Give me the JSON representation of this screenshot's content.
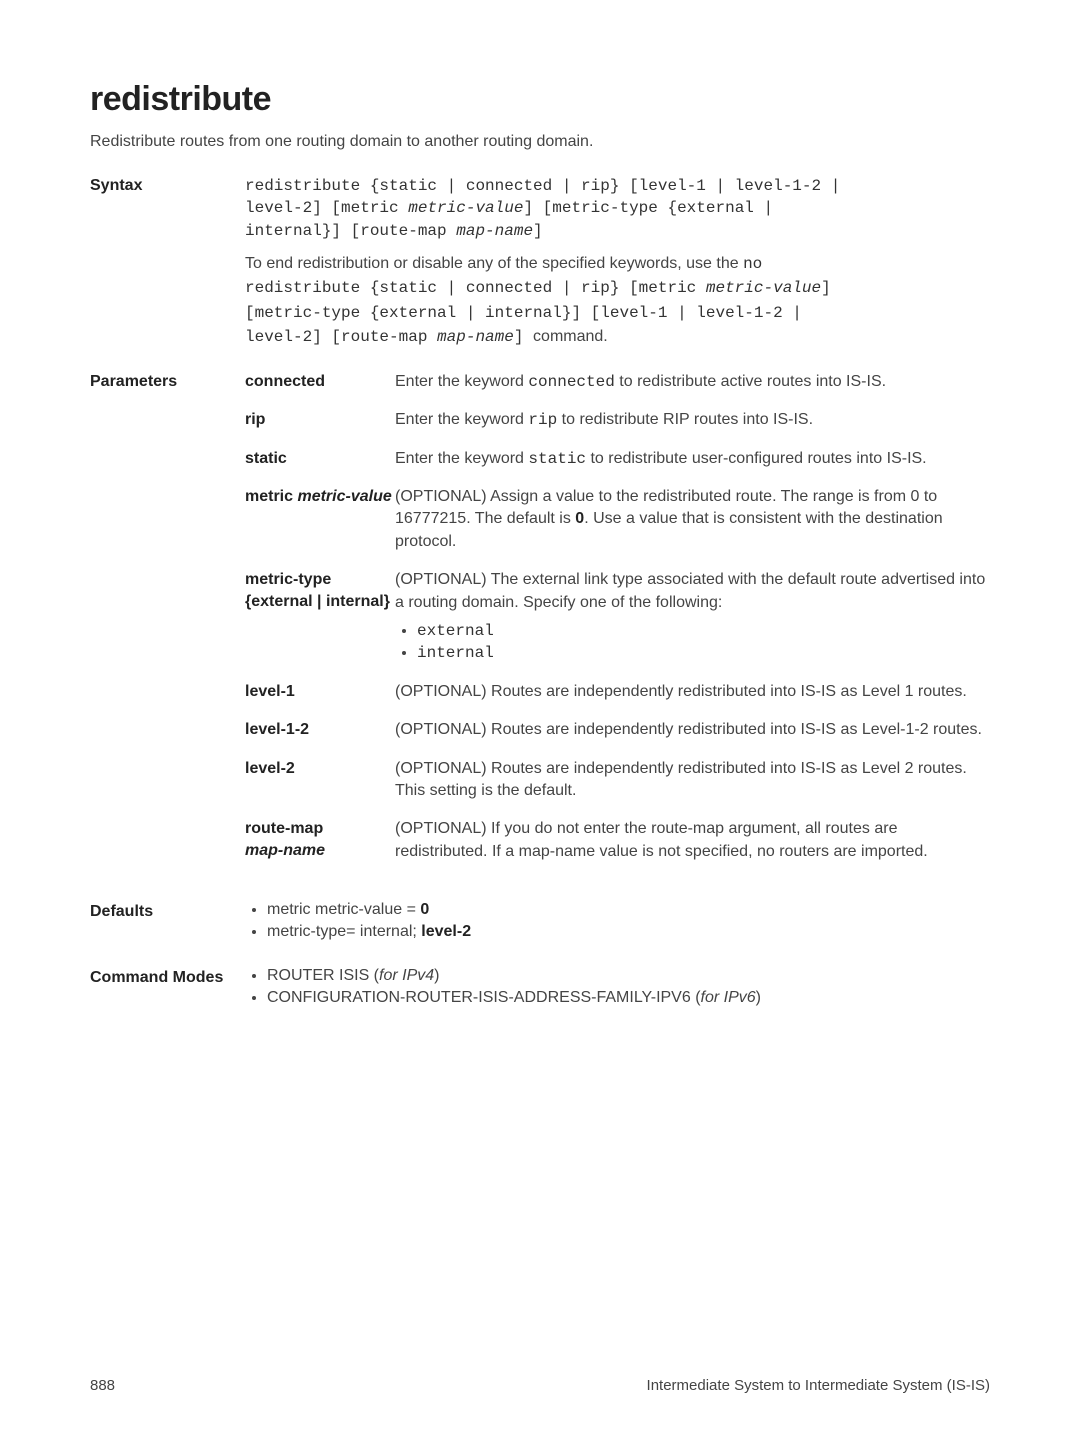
{
  "title": "redistribute",
  "intro": "Redistribute routes from one routing domain to another routing domain.",
  "syntax": {
    "label": "Syntax",
    "code_l1": "redistribute {static | connected | rip} [level-1 | level-1-2 |",
    "code_l2": "level-2] [metric ",
    "code_l2_ital": "metric-value",
    "code_l2b": "] [metric-type {external |",
    "code_l3": "internal}] [route-map ",
    "code_l3_ital": "map-name",
    "code_l3b": "]",
    "desc1": "To end redistribution or disable any of the specified keywords, use the ",
    "desc1_code": "no",
    "desc2_l1": "redistribute {static | connected | rip} [metric ",
    "desc2_l1_ital": "metric-value",
    "desc2_l1b": "]",
    "desc2_l2": "[metric-type {external | internal}] [level-1 | level-1-2 |",
    "desc2_l3": "level-2] [route-map ",
    "desc2_l3_ital": "map-name",
    "desc2_l3b": "] ",
    "desc2_tail": "command."
  },
  "parameters": {
    "label": "Parameters",
    "rows": {
      "connected_name": "connected",
      "connected_desc_a": "Enter the keyword ",
      "connected_desc_code": "connected",
      "connected_desc_b": " to redistribute active routes into IS-IS.",
      "rip_name": "rip",
      "rip_desc_a": "Enter the keyword ",
      "rip_desc_code": "rip",
      "rip_desc_b": " to redistribute RIP routes into IS-IS.",
      "static_name": "static",
      "static_desc_a": "Enter the keyword ",
      "static_desc_code": "static",
      "static_desc_b": " to redistribute user-configured routes into IS-IS.",
      "metric_name_a": "metric ",
      "metric_name_ital": "metric-value",
      "metric_desc_a": "(OPTIONAL) Assign a value to the redistributed route. The range is from 0 to 16777215. The default is ",
      "metric_desc_bold": "0",
      "metric_desc_b": ". Use a value that is consistent with the destination protocol.",
      "mtype_name": "metric-type {external | internal}",
      "mtype_desc": "(OPTIONAL) The external link type associated with the default route advertised into a routing domain. Specify one of the following:",
      "mtype_b1": "external",
      "mtype_b2": "internal",
      "l1_name": "level-1",
      "l1_desc": "(OPTIONAL) Routes are independently redistributed into IS-IS as Level 1 routes.",
      "l12_name": "level-1-2",
      "l12_desc": "(OPTIONAL) Routes are independently redistributed into IS-IS as Level-1-2 routes.",
      "l2_name": "level-2",
      "l2_desc": "(OPTIONAL) Routes are independently redistributed into IS-IS as Level 2 routes. This setting is the default.",
      "rm_name_a": "route-map",
      "rm_name_ital": "map-name",
      "rm_desc": "(OPTIONAL) If you do not enter the route-map argument, all routes are redistributed. If a map-name value is not specified, no routers are imported."
    }
  },
  "defaults": {
    "label": "Defaults",
    "b1_a": "metric metric-value = ",
    "b1_bold": "0",
    "b2_a": "metric-type= internal; ",
    "b2_bold": "level-2"
  },
  "modes": {
    "label": "Command Modes",
    "b1_a": "ROUTER ISIS (",
    "b1_ital": "for IPv4",
    "b1_b": ")",
    "b2_a": "CONFIGURATION-ROUTER-ISIS-ADDRESS-FAMILY-IPV6 (",
    "b2_ital": "for IPv6",
    "b2_b": ")"
  },
  "footer": {
    "page": "888",
    "title": "Intermediate System to Intermediate System (IS-IS)"
  }
}
